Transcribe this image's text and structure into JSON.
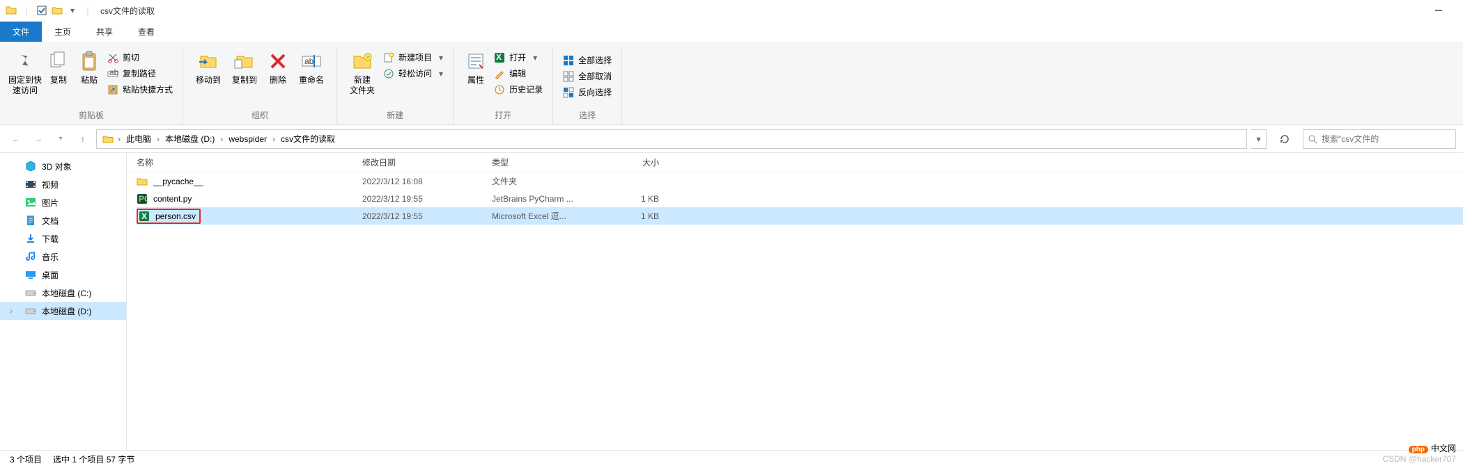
{
  "window": {
    "title": "csv文件的读取"
  },
  "tabs": {
    "file": "文件",
    "home": "主页",
    "share": "共享",
    "view": "查看"
  },
  "ribbon": {
    "clipboard": {
      "label": "剪贴板",
      "pin": "固定到快速访问",
      "copy": "复制",
      "paste": "粘贴",
      "cut": "剪切",
      "copypath": "复制路径",
      "pasteshortcut": "粘贴快捷方式"
    },
    "organize": {
      "label": "组织",
      "moveto": "移动到",
      "copyto": "复制到",
      "delete": "删除",
      "rename": "重命名"
    },
    "new_": {
      "label": "新建",
      "newfolder": "新建\n文件夹",
      "newitem": "新建项目",
      "easyaccess": "轻松访问"
    },
    "open": {
      "label": "打开",
      "properties": "属性",
      "open": "打开",
      "edit": "编辑",
      "history": "历史记录"
    },
    "select": {
      "label": "选择",
      "selectall": "全部选择",
      "selectnone": "全部取消",
      "invert": "反向选择"
    }
  },
  "breadcrumbs": [
    "此电脑",
    "本地磁盘 (D:)",
    "webspider",
    "csv文件的读取"
  ],
  "search_placeholder": "搜索\"csv文件的",
  "tree": [
    {
      "label": "3D 对象",
      "icon": "cube",
      "color": "#32b3e6"
    },
    {
      "label": "视频",
      "icon": "video",
      "color": "#34495e"
    },
    {
      "label": "图片",
      "icon": "pic",
      "color": "#2ecc71"
    },
    {
      "label": "文档",
      "icon": "doc",
      "color": "#3498db"
    },
    {
      "label": "下载",
      "icon": "dl",
      "color": "#2980d9"
    },
    {
      "label": "音乐",
      "icon": "music",
      "color": "#1e90ff"
    },
    {
      "label": "桌面",
      "icon": "desk",
      "color": "#2d9cf0"
    },
    {
      "label": "本地磁盘 (C:)",
      "icon": "drive",
      "color": "#9aa0a6"
    },
    {
      "label": "本地磁盘 (D:)",
      "icon": "drive",
      "color": "#9aa0a6",
      "selected": true
    }
  ],
  "columns": {
    "name": "名称",
    "date": "修改日期",
    "type": "类型",
    "size": "大小"
  },
  "files": [
    {
      "name": "__pycache__",
      "date": "2022/3/12 16:08",
      "type": "文件夹",
      "size": "",
      "icon": "folder"
    },
    {
      "name": "content.py",
      "date": "2022/3/12 19:55",
      "type": "JetBrains PyCharm ...",
      "size": "1 KB",
      "icon": "py"
    },
    {
      "name": "person.csv",
      "date": "2022/3/12 19:55",
      "type": "Microsoft Excel 逗...",
      "size": "1 KB",
      "icon": "xl",
      "selected": true,
      "highlight": true
    }
  ],
  "status": {
    "count": "3 个项目",
    "sel": "选中 1 个项目 57 字节"
  },
  "watermark": {
    "php": "php",
    "cn": "中文网",
    "csdn": "CSDN @hacker707"
  }
}
